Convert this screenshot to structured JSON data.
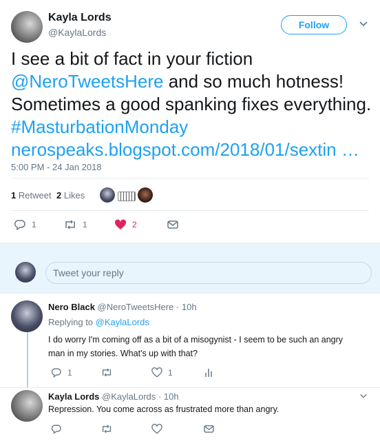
{
  "main_tweet": {
    "author_name": "Kayla Lords",
    "author_handle": "@KaylaLords",
    "follow_label": "Follow",
    "text_line1": "I see a bit of fact in your fiction",
    "mention": "@NeroTweetsHere",
    "text_line2_rest": " and so much hotness!",
    "text_line3": "Sometimes a good spanking fixes everything.",
    "hashtag": "#MasturbationMonday",
    "link": "nerospeaks.blogspot.com/2018/01/sextin …",
    "timestamp": "5:00 PM - 24 Jan 2018",
    "retweets_count": "1",
    "retweets_label": "Retweet",
    "likes_count": "2",
    "likes_label": "Likes",
    "actions": {
      "reply_count": "1",
      "retweet_count": "1",
      "like_count": "2"
    }
  },
  "reply_input": {
    "placeholder": "Tweet your reply"
  },
  "replies": [
    {
      "author_name": "Nero Black",
      "author_handle": "@NeroTweetsHere",
      "time": "· 10h",
      "replying_to_label": "Replying to",
      "replying_to_handle": "@KaylaLords",
      "text_line1": "I do worry I'm coming off as a bit of a misogynist - I seem to be such an angry",
      "text_line2": "man in my stories. What's up with that?",
      "reply_count": "1",
      "like_count": "1"
    },
    {
      "author_name": "Kayla Lords",
      "author_handle": "@KaylaLords",
      "time": "· 10h",
      "text": "Repression. You come across as frustrated more than angry."
    }
  ],
  "colors": {
    "accent": "#1da1f2",
    "like": "#e0245e",
    "muted": "#657786"
  }
}
